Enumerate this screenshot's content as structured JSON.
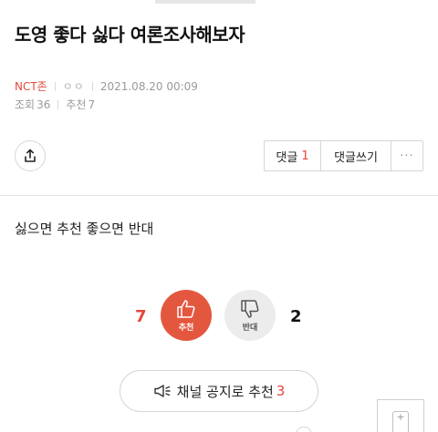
{
  "post": {
    "title": "도영 좋다 싫다 여론조사해보자",
    "board": "NCT존",
    "author": "ㅇㅇ",
    "date": "2021.08.20 00:09",
    "views_label": "조회",
    "views": "36",
    "recommend_label": "추천",
    "recommend": "7",
    "body": "싫으면 추천 좋으면 반대"
  },
  "actions": {
    "comments_label": "댓글",
    "comments_count": "1",
    "write_comment_label": "댓글쓰기",
    "more_label": "···"
  },
  "vote": {
    "up_count": "7",
    "up_label": "추천",
    "down_count": "2",
    "down_label": "반대"
  },
  "notice": {
    "label": "채널 공지로 추천",
    "count": "3"
  },
  "colors": {
    "accent": "#e4483a",
    "upvote_bg": "#e4573f",
    "downvote_bg": "#ececec"
  },
  "icons": {
    "share": "share-icon",
    "thumbs_up": "thumbs-up-icon",
    "thumbs_down": "thumbs-down-icon",
    "speaker": "megaphone-icon",
    "scroll": "scroll-widget-icon"
  }
}
